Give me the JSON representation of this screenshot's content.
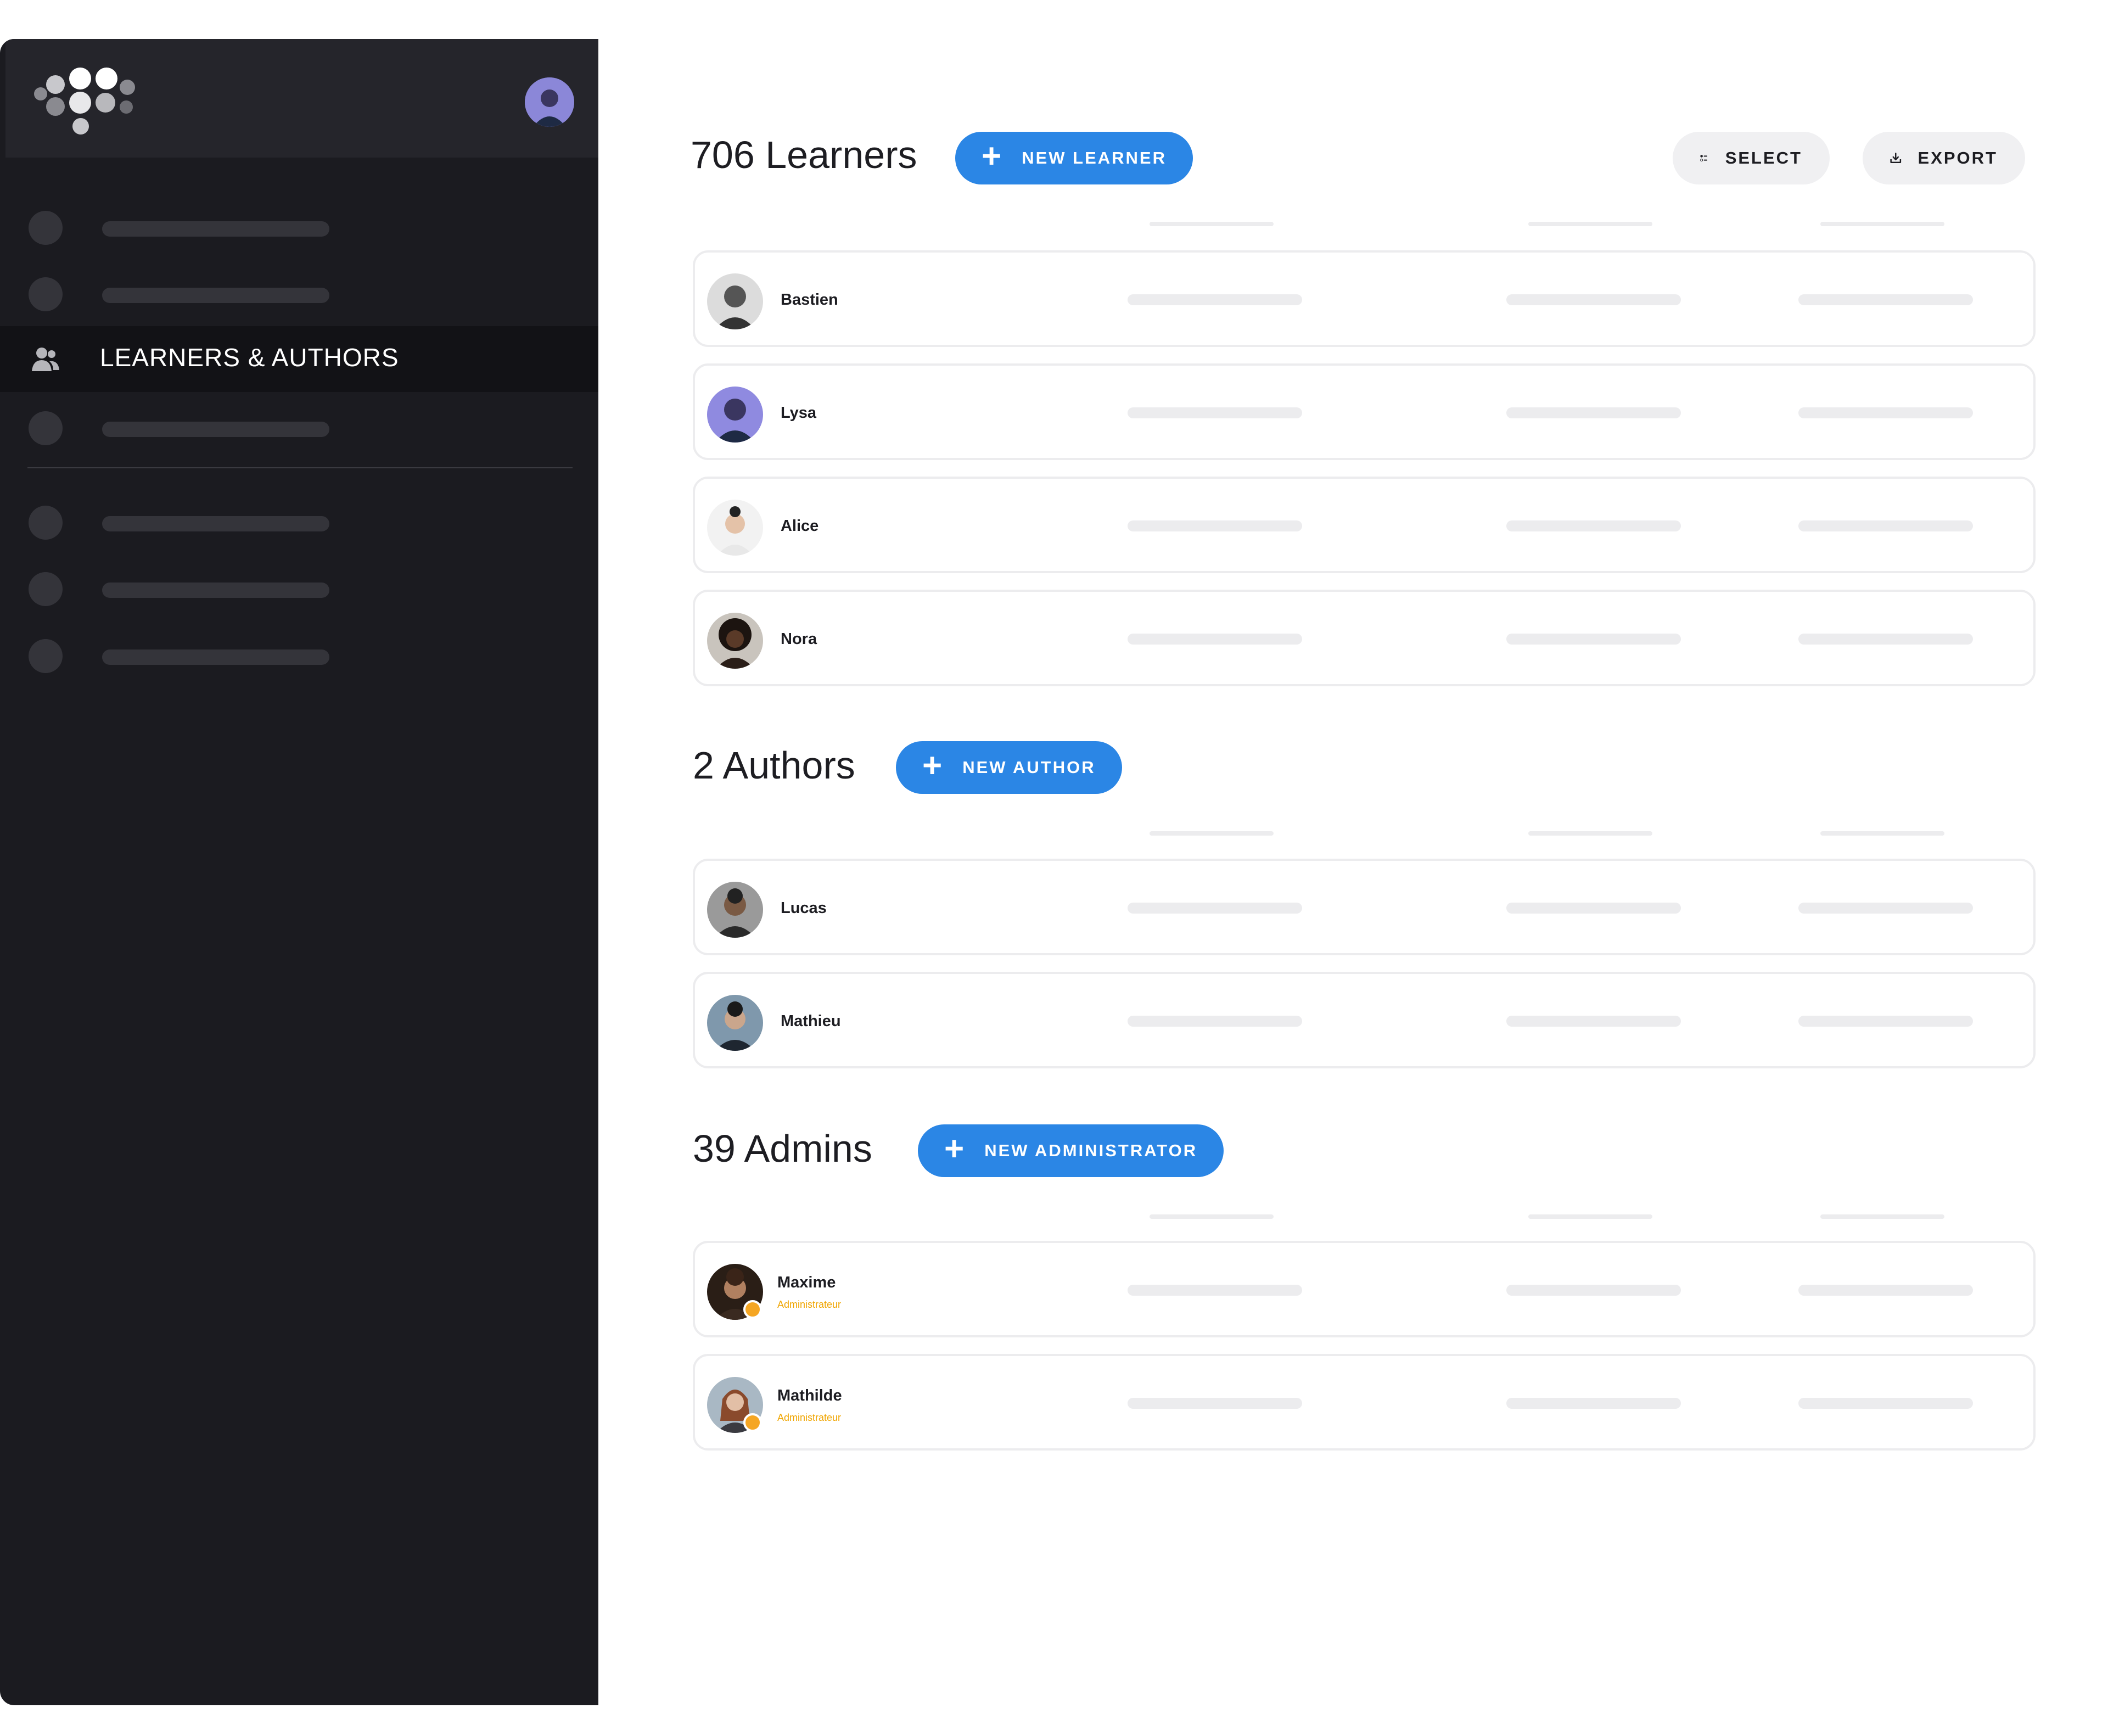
{
  "sidebar": {
    "active_item_label": "LEARNERS & AUTHORS",
    "icons": {
      "logo": "dots-logo",
      "active": "users-icon"
    }
  },
  "learners": {
    "title": "706 Learners",
    "new_button": "NEW LEARNER",
    "select_button": "SELECT",
    "export_button": "EXPORT",
    "rows": [
      {
        "name": "Bastien"
      },
      {
        "name": "Lysa"
      },
      {
        "name": "Alice"
      },
      {
        "name": "Nora"
      }
    ]
  },
  "authors": {
    "title": "2 Authors",
    "new_button": "NEW AUTHOR",
    "rows": [
      {
        "name": "Lucas"
      },
      {
        "name": "Mathieu"
      }
    ]
  },
  "admins": {
    "title": "39 Admins",
    "new_button": "NEW ADMINISTRATOR",
    "rows": [
      {
        "name": "Maxime",
        "role": "Administrateur"
      },
      {
        "name": "Mathilde",
        "role": "Administrateur"
      }
    ]
  },
  "colors": {
    "primary": "#2b86e5",
    "sidebar_bg": "#1b1b20",
    "admin_badge": "#f5a623"
  }
}
